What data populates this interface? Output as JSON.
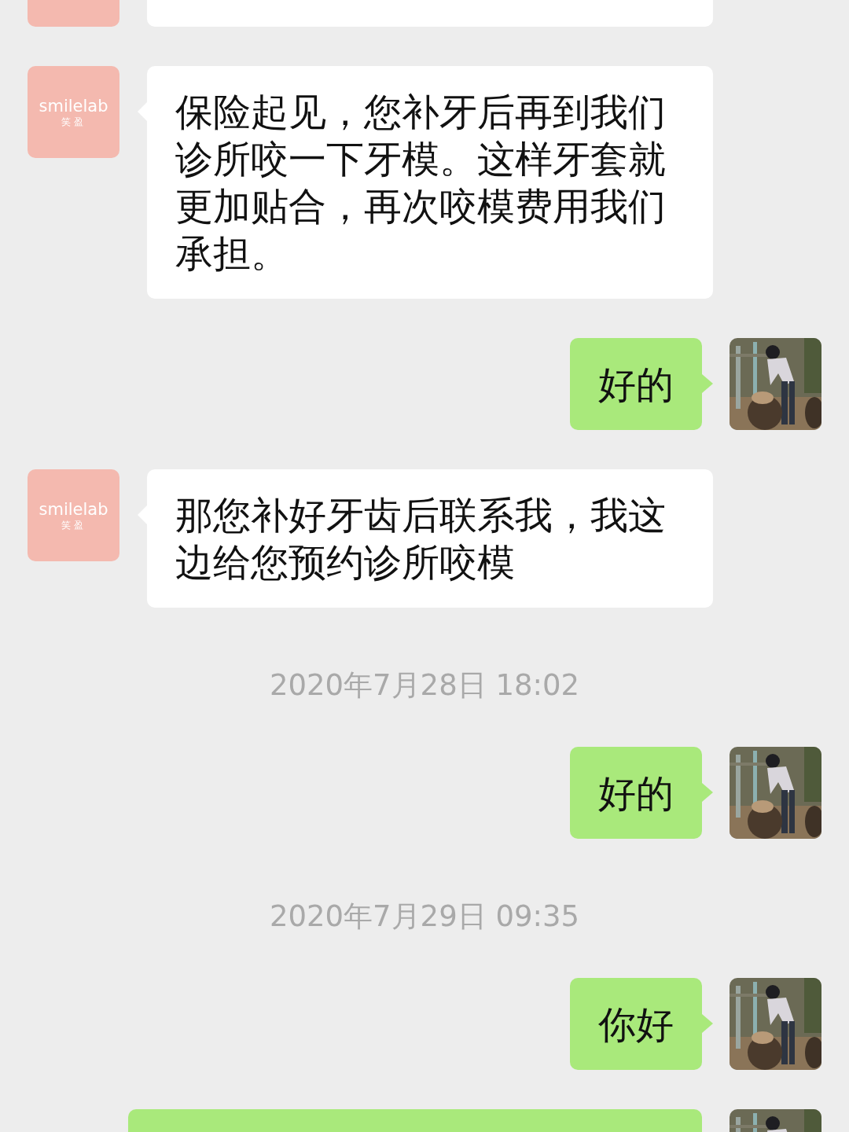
{
  "messages": [
    {
      "kind": "in",
      "avatar": {
        "kind": "logo"
      }
    },
    {
      "kind": "in",
      "avatar": {
        "kind": "logo",
        "logo": "smilelab",
        "logo_sub": "笑盈"
      },
      "text": "保险起见，您补牙后再到我们诊所咬一下牙模。这样牙套就更加贴合，再次咬模费用我们承担。"
    },
    {
      "kind": "out",
      "text": "好的"
    },
    {
      "kind": "in",
      "avatar": {
        "kind": "logo",
        "logo": "smilelab",
        "logo_sub": "笑盈"
      },
      "text": "那您补好牙齿后联系我，我这边给您预约诊所咬模"
    },
    {
      "kind": "time",
      "text": "2020年7月28日 18:02"
    },
    {
      "kind": "out",
      "text": "好的"
    },
    {
      "kind": "time",
      "text": "2020年7月29日 09:35"
    },
    {
      "kind": "out",
      "text": "你好"
    },
    {
      "kind": "out",
      "wide": true
    }
  ]
}
